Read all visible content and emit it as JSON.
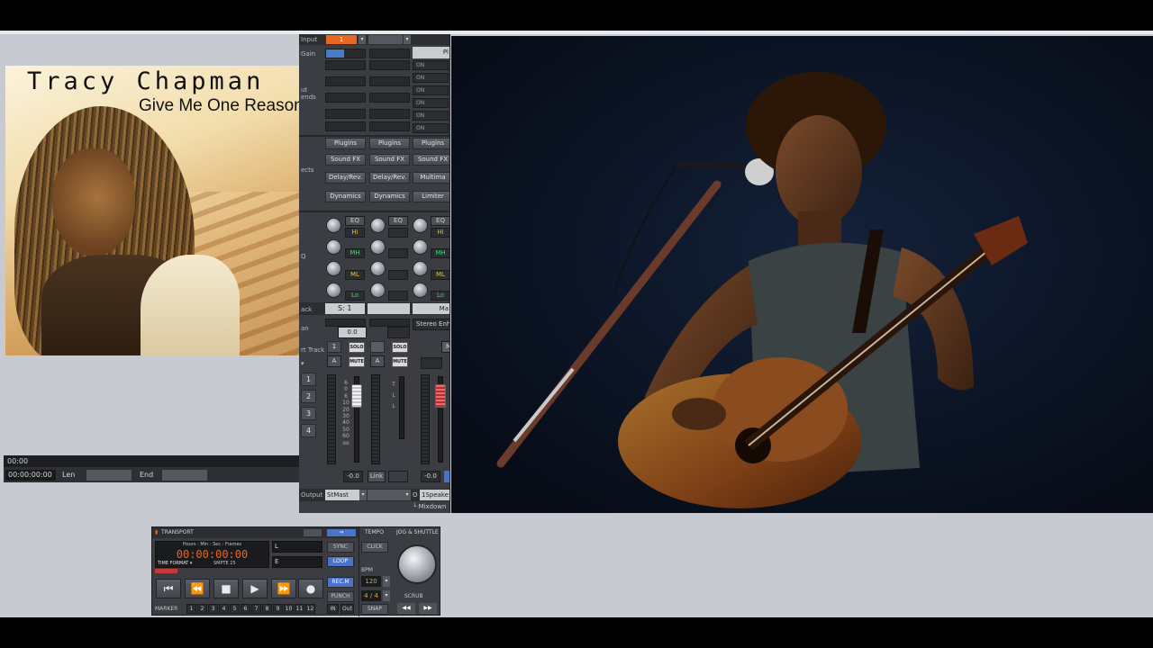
{
  "album": {
    "artist": "Tracy Chapman",
    "title": "Give Me One Reason"
  },
  "left_panel": {
    "time_top": "00:00",
    "position": "00:00:00:00",
    "len_label": "Len",
    "end_label": "End"
  },
  "mixer": {
    "input_label": "Input",
    "input_value": "1",
    "gain_label": "Gain",
    "on_labels": [
      "ON",
      "ON",
      "ON",
      "ON",
      "ON",
      "ON"
    ],
    "plugin_header": "Pl",
    "plugins_row": [
      "Plugins",
      "Plugins",
      "Plugins"
    ],
    "soundfx_row": [
      "Sound FX",
      "Sound FX",
      "Sound FX"
    ],
    "delay_row": [
      "Delay/Rev.",
      "Delay/Rev.",
      "Multima"
    ],
    "dynamics_row": [
      "Dynamics",
      "Dynamics",
      "Limiter"
    ],
    "eq_button": "EQ",
    "eq_bands": [
      "Hi",
      "MH",
      "ML",
      "Lo"
    ],
    "eq_side_label": "Q",
    "track_label": "ack",
    "send_label": "S: 1",
    "master_label": "Ma",
    "pan_label": "an",
    "pan_value": "0.0",
    "stereo_label": "Stereo Enh",
    "arm_label": "rt Track",
    "channel_nums": [
      "1",
      "2",
      "3",
      "4"
    ],
    "solo": "SOLO",
    "mute": "MUTE",
    "a_label": "A",
    "fader_scale": [
      "6",
      "0",
      "6",
      "10",
      "20",
      "30",
      "40",
      "50",
      "60",
      "oo"
    ],
    "eq_scale": [
      "T",
      "L",
      "L"
    ],
    "vol_left": "-0.0",
    "vol_right": "-0.0",
    "link": "Link",
    "output_label": "Output",
    "output_value": "StMast",
    "output_right": "1Speake",
    "output_o": "O",
    "mixdown": "Mixdown",
    "m_btn": "M",
    "one_small": "1"
  },
  "transport": {
    "title": "TRANSPORT",
    "tempo": "TEMPO",
    "jog": "JOG & SHUTTLE",
    "format_header": "Hours : Min : Sec : Frames",
    "time": "00:00:00:00",
    "time_format": "TIME FORMAT",
    "smpte": "SMPTE 25",
    "l_label": "L",
    "e_label": "E",
    "sync": "SYNC",
    "loop": "LOOP",
    "recm": "REC.M",
    "punch": "PUNCH",
    "click": "CLICK",
    "bpm_label": "BPM",
    "bpm": "120",
    "sig": "4 / 4",
    "snap": "SNAP",
    "scrub": "SCRUB",
    "marker": "MARKER",
    "markers": [
      "1",
      "2",
      "3",
      "4",
      "5",
      "6",
      "7",
      "8",
      "9",
      "10",
      "11",
      "12"
    ],
    "in_label": "IN",
    "out_label": "Out",
    "buttons": {
      "rewind_start": "⏮",
      "rewind": "⏪",
      "stop": "■",
      "play": "▶",
      "ffwd": "⏩",
      "record": "●"
    },
    "jog_prev": "◀◀",
    "jog_next": "▶▶"
  }
}
